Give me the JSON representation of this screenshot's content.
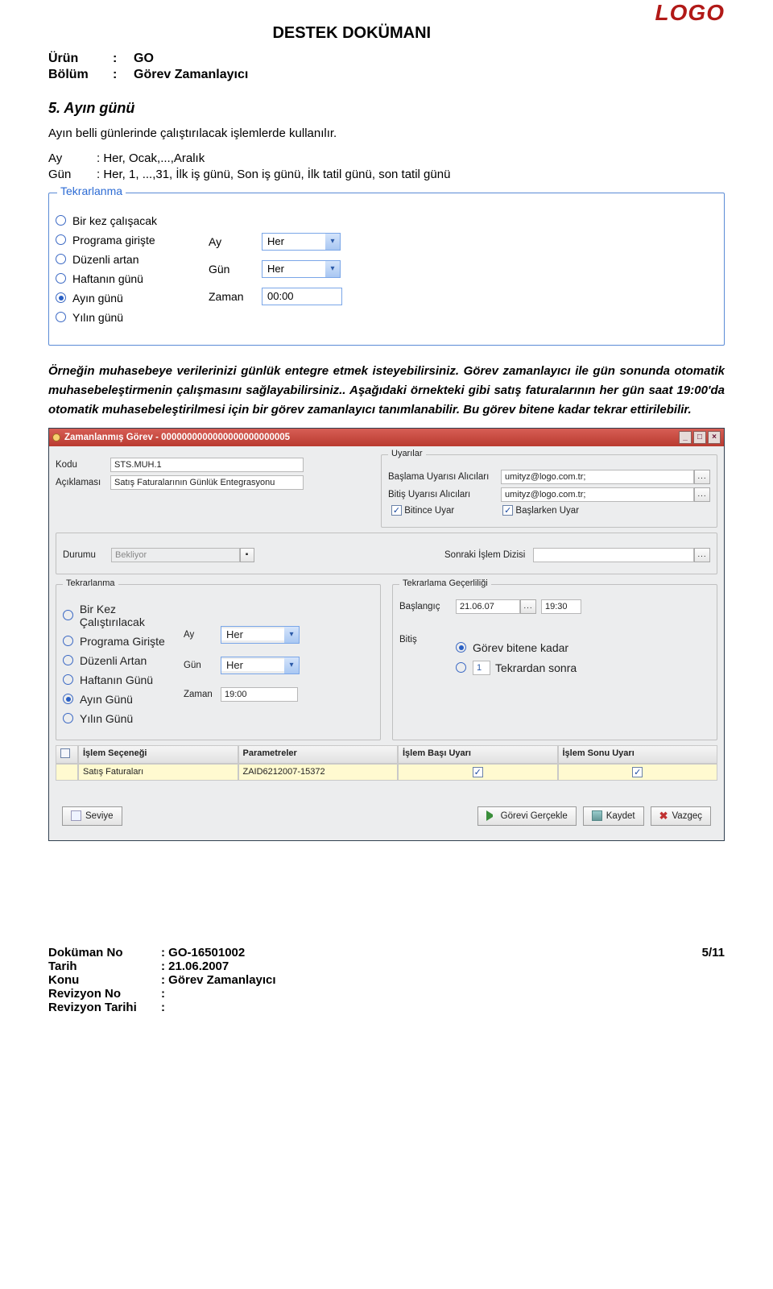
{
  "doc": {
    "title": "DESTEK DOKÜMANI",
    "urun_k": "Ürün",
    "urun_v": "GO",
    "bolum_k": "Bölüm",
    "bolum_v": "Görev Zamanlayıcı",
    "logo": "LOGO"
  },
  "sec5": {
    "heading": "5. Ayın günü",
    "p1": "Ayın belli günlerinde çalıştırılacak işlemlerde kullanılır.",
    "ay_k": "Ay",
    "ay_v": ": Her, Ocak,...,Aralık",
    "gun_k": "Gün",
    "gun_v": ": Her, 1, ...,31, İlk iş günü, Son iş günü, İlk tatil günü, son tatil günü"
  },
  "tek": {
    "legend": "Tekrarlanma",
    "r1": "Bir kez çalışacak",
    "r2": "Programa girişte",
    "r3": "Düzenli artan",
    "r4": "Haftanın günü",
    "r5": "Ayın günü",
    "r6": "Yılın günü",
    "ay_l": "Ay",
    "ay_v": "Her",
    "gun_l": "Gün",
    "gun_v": "Her",
    "z_l": "Zaman",
    "z_v": "00:00"
  },
  "para": {
    "p1": "Örneğin muhasebeye verilerinizi günlük entegre etmek isteyebilirsiniz. Görev zamanlayıcı ile gün sonunda otomatik muhasebeleştirmenin çalışmasını sağlayabilirsiniz.. Aşağıdaki örnekteki gibi satış faturalarının her gün saat 19:00'da otomatik muhasebeleştirilmesi için bir görev zamanlayıcı tanımlanabilir. Bu görev bitene kadar tekrar ettirilebilir."
  },
  "win": {
    "title": "Zamanlanmış Görev - 0000000000000000000000005",
    "kodu_l": "Kodu",
    "kodu_v": "STS.MUH.1",
    "acik_l": "Açıklaması",
    "acik_v": "Satış Faturalarının Günlük Entegrasyonu",
    "uyar_legend": "Uyarılar",
    "basla_l": "Başlama Uyarısı Alıcıları",
    "basla_v": "umityz@logo.com.tr;",
    "bitis_l": "Bitiş Uyarısı Alıcıları",
    "bitis_v": "umityz@logo.com.tr;",
    "bitince": "Bitince Uyar",
    "baslarken": "Başlarken Uyar",
    "durum_l": "Durumu",
    "durum_v": "Bekliyor",
    "sonraki_l": "Sonraki İşlem Dizisi",
    "tek_legend": "Tekrarlanma",
    "tr1": "Bir Kez Çalıştırılacak",
    "tr2": "Programa Girişte",
    "tr3": "Düzenli Artan",
    "tr4": "Haftanın Günü",
    "tr5": "Ayın Günü",
    "tr6": "Yılın Günü",
    "tay_l": "Ay",
    "tay_v": "Her",
    "tgun_l": "Gün",
    "tgun_v": "Her",
    "tz_l": "Zaman",
    "tz_v": "19:00",
    "gec_legend": "Tekrarlama Geçerliliği",
    "bas_l": "Başlangıç",
    "bas_date": "21.06.07",
    "bas_time": "19:30",
    "bit_l": "Bitiş",
    "opt1": "Görev bitene kadar",
    "opt2": "Tekrardan sonra",
    "th0": "",
    "th1": "İşlem Seçeneği",
    "th2": "Parametreler",
    "th3": "İşlem Başı Uyarı",
    "th4": "İşlem Sonu Uyarı",
    "td1": "Satış Faturaları",
    "td2": "ZAID6212007-15372",
    "b_seviye": "Seviye",
    "b_gercek": "Görevi Gerçekle",
    "b_kaydet": "Kaydet",
    "b_vazgec": "Vazgeç"
  },
  "foot": {
    "dokno_k": "Doküman No",
    "dokno_v": ": GO-16501002",
    "tarih_k": "Tarih",
    "tarih_v": ": 21.06.2007",
    "konu_k": "Konu",
    "konu_v": ": Görev Zamanlayıcı",
    "revno_k": "Revizyon No",
    "revno_v": ":",
    "revt_k": "Revizyon Tarihi",
    "revt_v": ":",
    "page": "5/11"
  }
}
